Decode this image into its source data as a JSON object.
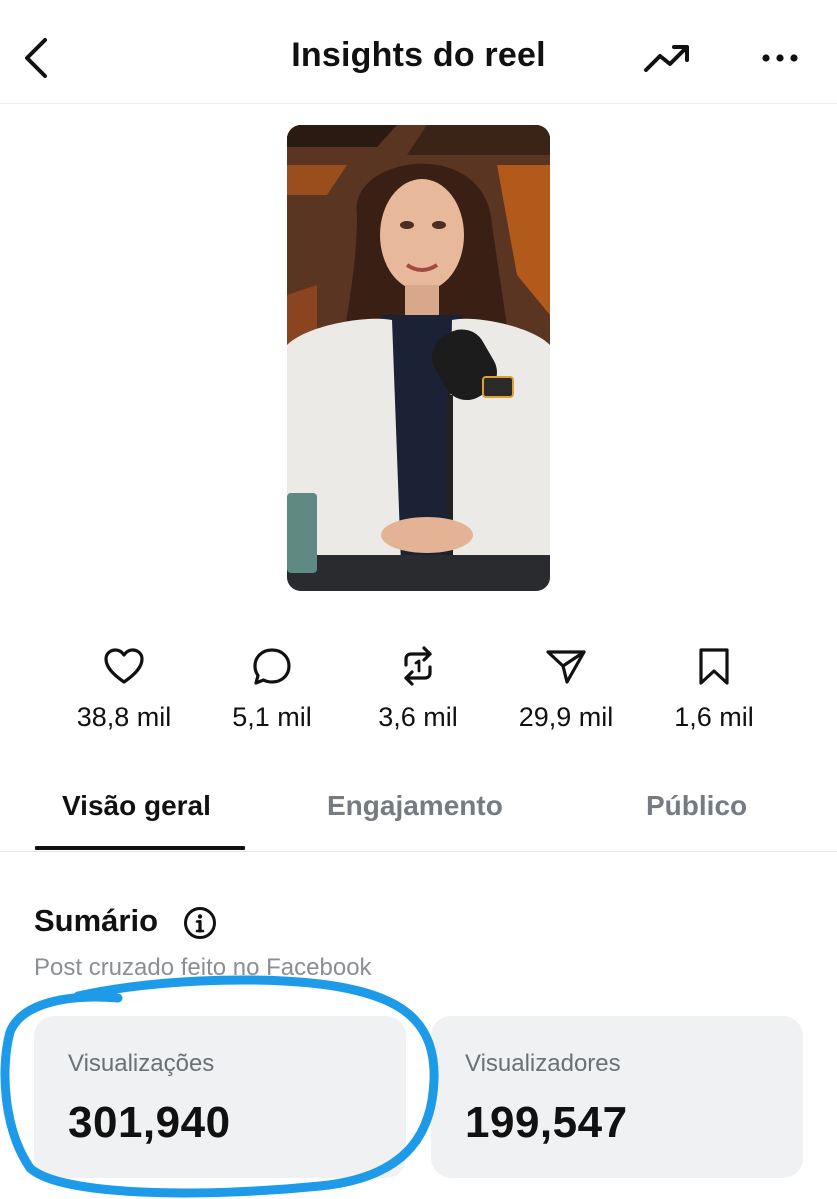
{
  "header": {
    "title": "Insights do reel"
  },
  "stats": [
    {
      "icon": "heart-icon",
      "value": "38,8 mil"
    },
    {
      "icon": "comment-icon",
      "value": "5,1 mil"
    },
    {
      "icon": "repost-icon",
      "value": "3,6 mil"
    },
    {
      "icon": "share-icon",
      "value": "29,9 mil"
    },
    {
      "icon": "bookmark-icon",
      "value": "1,6 mil"
    }
  ],
  "tabs": [
    {
      "label": "Visão geral",
      "active": true
    },
    {
      "label": "Engajamento",
      "active": false
    },
    {
      "label": "Público",
      "active": false
    }
  ],
  "summary": {
    "title": "Sumário",
    "subtitle": "Post cruzado feito no Facebook",
    "cards": [
      {
        "label": "Visualizações",
        "value": "301,940"
      },
      {
        "label": "Visualizadores",
        "value": "199,547"
      }
    ]
  },
  "colors": {
    "highlight_stroke": "#1e9be8",
    "card_bg": "#eff1f3",
    "muted_text": "#757b80"
  }
}
